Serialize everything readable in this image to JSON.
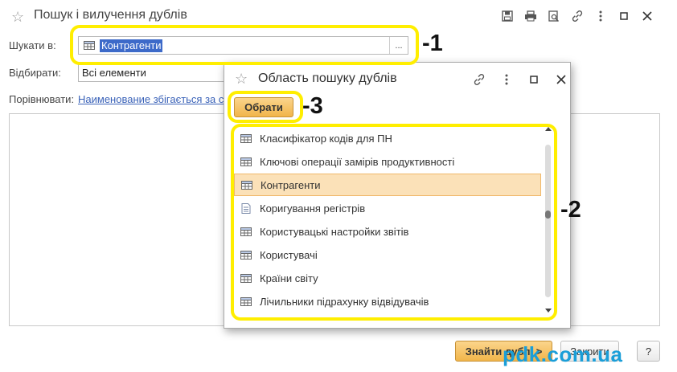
{
  "window": {
    "title": "Пошук і вилучення дублів",
    "toolbar": [
      "save-icon",
      "print-icon",
      "print-preview-icon",
      "link-icon",
      "more-icon",
      "maximize-icon",
      "close-icon"
    ]
  },
  "form": {
    "search_in_label": "Шукати в:",
    "search_in_value": "Контрагенти",
    "select_button": "...",
    "filter_label": "Відбирати:",
    "filter_value": "Всі елементи",
    "compare_label": "Порівнювати:",
    "compare_link": "Наименование збігається за с"
  },
  "dialog": {
    "title": "Область пошуку дублів",
    "choose_button": "Обрати",
    "items": [
      {
        "label": "Класифікатор кодів для ПН",
        "icon": "table-icon",
        "selected": false
      },
      {
        "label": "Ключові операції замірів продуктивності",
        "icon": "table-icon",
        "selected": false
      },
      {
        "label": "Контрагенти",
        "icon": "table-icon",
        "selected": true
      },
      {
        "label": "Коригування регістрів",
        "icon": "document-icon",
        "selected": false
      },
      {
        "label": "Користувацькі настройки звітів",
        "icon": "table-icon",
        "selected": false
      },
      {
        "label": "Користувачі",
        "icon": "table-icon",
        "selected": false
      },
      {
        "label": "Країни світу",
        "icon": "table-icon",
        "selected": false
      },
      {
        "label": "Лічильники підрахунку відвідувачів",
        "icon": "table-icon",
        "selected": false
      }
    ]
  },
  "footer": {
    "find_button": "Знайти дублі >",
    "close_button": "Закрити",
    "help_button": "?"
  },
  "annotations": {
    "m1": "-1",
    "m2": "-2",
    "m3": "-3"
  },
  "watermark": "pdk.com.ua",
  "colors": {
    "highlight": "#ffee00",
    "selection": "#3d6ac9",
    "accent": "#f1b54a",
    "link": "#3a62b8"
  }
}
